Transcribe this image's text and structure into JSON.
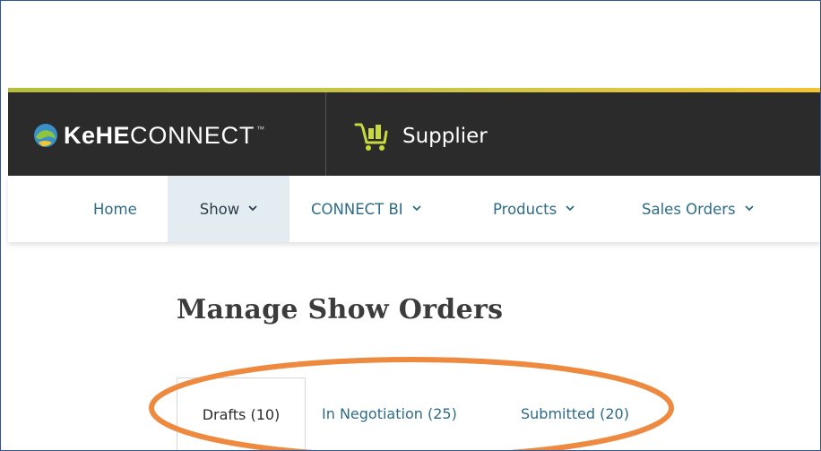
{
  "brand": {
    "bold": "KeHE",
    "light": "CONNECT",
    "tm": "™",
    "globe_icon": "globe-icon"
  },
  "header": {
    "portal_label": "Supplier",
    "portal_icon": "shopping-cart-icon",
    "accent_colors": [
      "#b5bd3a",
      "#f2c531"
    ],
    "background": "#2b2b2b"
  },
  "nav": {
    "items": [
      {
        "label": "Home",
        "has_dropdown": false,
        "active": false
      },
      {
        "label": "Show",
        "has_dropdown": true,
        "active": true
      },
      {
        "label": "CONNECT BI",
        "has_dropdown": true,
        "active": false
      },
      {
        "label": "Products",
        "has_dropdown": true,
        "active": false
      },
      {
        "label": "Sales Orders",
        "has_dropdown": true,
        "active": false
      }
    ],
    "link_color": "#2d6b88",
    "active_background": "#e3ecf1"
  },
  "main": {
    "title": "Manage Show Orders",
    "tabs": [
      {
        "label": "Drafts (10)",
        "active": true
      },
      {
        "label": "In Negotiation (25)",
        "active": false
      },
      {
        "label": "Submitted (20)",
        "active": false
      }
    ]
  },
  "annotation": {
    "color": "#ed8a3f",
    "shape": "ellipse"
  }
}
